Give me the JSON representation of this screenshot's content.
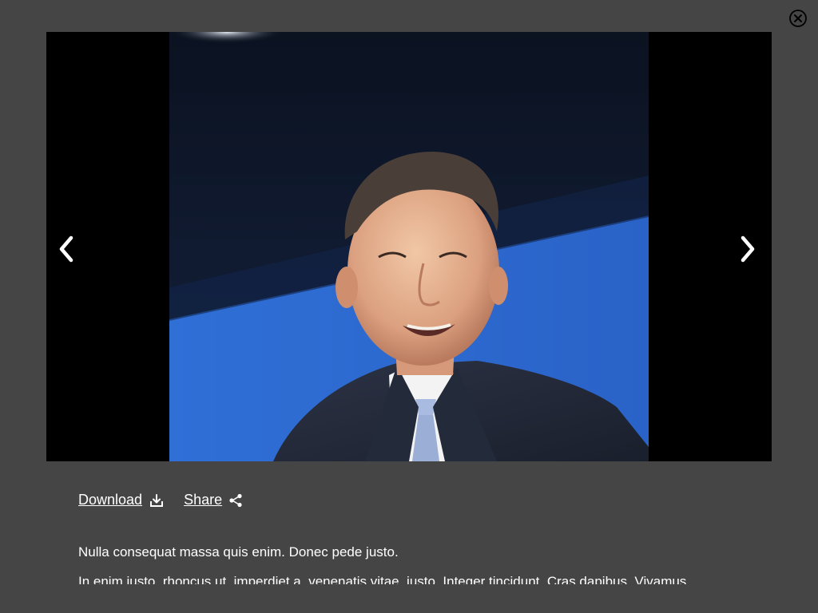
{
  "lightbox": {
    "image_alt": "Smiling man in a pinstriped suit and light blue tie on stage against a blue backdrop",
    "prev_icon": "chevron-left-icon",
    "next_icon": "chevron-right-icon",
    "close_icon": "close-circle-icon"
  },
  "actions": {
    "download_label": "Download",
    "download_icon": "download-icon",
    "share_label": "Share",
    "share_icon": "share-icon"
  },
  "caption": {
    "line1": "Nulla consequat massa quis enim. Donec pede justo.",
    "line2": "In enim justo, rhoncus ut, imperdiet a, venenatis vitae, justo. Integer tincidunt. Cras dapibus. Vivamus"
  },
  "colors": {
    "overlay_bg": "#454545",
    "stage_bg": "#000000",
    "text": "#ffffff"
  }
}
